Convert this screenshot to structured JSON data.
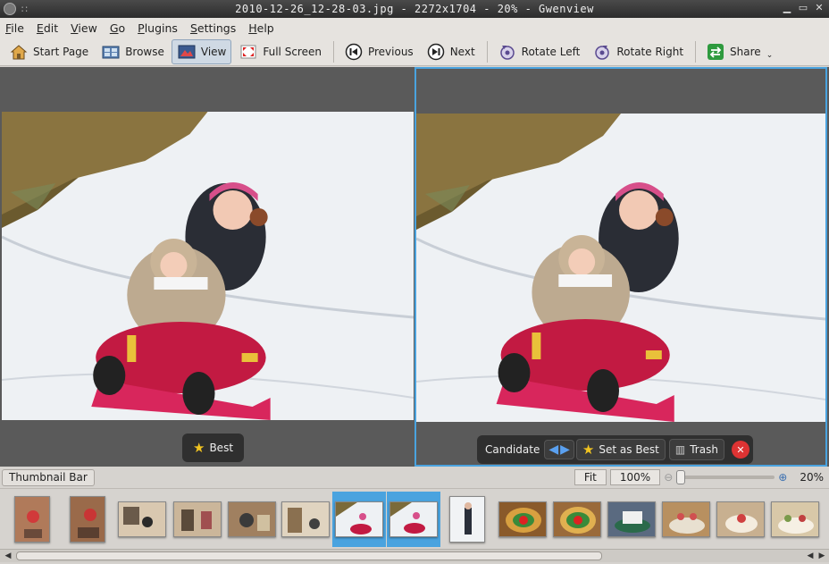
{
  "window": {
    "title": "2010-12-26_12-28-03.jpg - 2272x1704 - 20% - Gwenview"
  },
  "menubar": {
    "items": [
      "File",
      "Edit",
      "View",
      "Go",
      "Plugins",
      "Settings",
      "Help"
    ]
  },
  "toolbar": {
    "start_page": "Start Page",
    "browse": "Browse",
    "view": "View",
    "full_screen": "Full Screen",
    "previous": "Previous",
    "next": "Next",
    "rotate_left": "Rotate Left",
    "rotate_right": "Rotate Right",
    "share": "Share"
  },
  "left_pane": {
    "best_label": "Best"
  },
  "right_pane": {
    "candidate_label": "Candidate",
    "set_as_best": "Set as Best",
    "trash": "Trash"
  },
  "statusbar": {
    "thumbnail_bar": "Thumbnail Bar",
    "fit": "Fit",
    "hundred": "100%",
    "zoom": "20%"
  },
  "colors": {
    "selection": "#4aa3df",
    "accent_star": "#f2c420",
    "close_red": "#d33"
  }
}
